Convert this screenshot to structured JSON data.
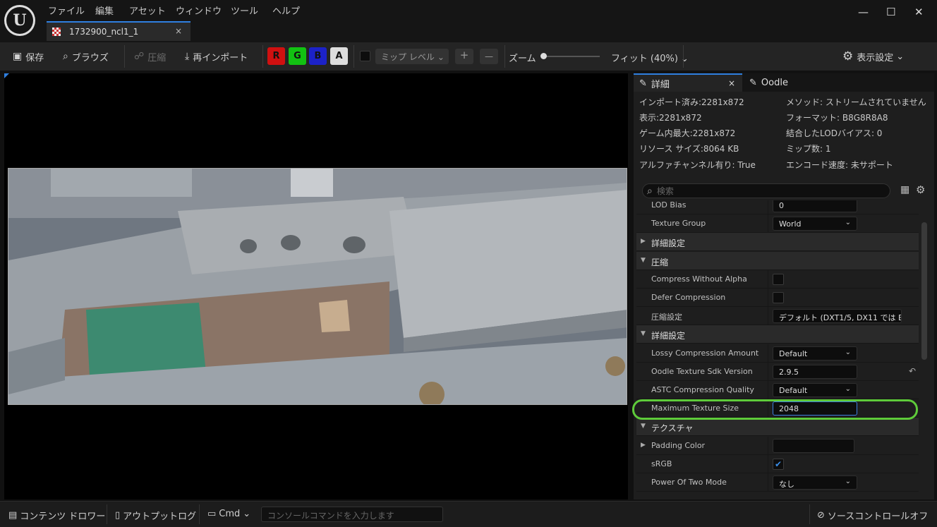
{
  "titlebar": {
    "logo": "U",
    "menu": [
      "ファイル",
      "編集",
      "アセット",
      "ウィンドウ",
      "ツール",
      "ヘルプ"
    ],
    "tab_title": "1732900_ncl1_1",
    "tab_close": "×",
    "minimize": "—",
    "maximize": "☐",
    "close": "✕"
  },
  "toolbar": {
    "save": "保存",
    "browse": "ブラウズ",
    "compress": "圧縮",
    "reimport": "再インポート",
    "channels": [
      {
        "label": "R",
        "bg": "#d01010",
        "fg": "#111"
      },
      {
        "label": "G",
        "bg": "#12c212",
        "fg": "#111"
      },
      {
        "label": "B",
        "bg": "#1c22c8",
        "fg": "#111"
      },
      {
        "label": "A",
        "bg": "#dddddd",
        "fg": "#111"
      }
    ],
    "mip_level": "ミップ レベル",
    "plus": "+",
    "minus": "—",
    "zoom_label": "ズーム",
    "zoom_value": "フィット (40%)",
    "view_settings": "表示設定"
  },
  "details": {
    "tab_details": "詳細",
    "tab_oodle": "Oodle",
    "info_left": [
      "インポート済み:2281x872",
      "表示:2281x872",
      "ゲーム内最大:2281x872",
      "リソース サイズ:8064 KB",
      "アルファチャンネル有り: True"
    ],
    "info_right": [
      "メソッド: ストリームされていません",
      "フォーマット: B8G8R8A8",
      "結合したLODバイアス: 0",
      "ミップ数: 1",
      "エンコード速度: 未サポート"
    ],
    "search_placeholder": "検索",
    "rows": [
      {
        "type": "prop",
        "label": "LOD Bias",
        "kind": "text",
        "value": "0"
      },
      {
        "type": "prop",
        "label": "Texture Group",
        "kind": "combo",
        "value": "World"
      },
      {
        "type": "cat",
        "label": "詳細設定",
        "open": false
      },
      {
        "type": "cat",
        "label": "圧縮",
        "open": true
      },
      {
        "type": "prop",
        "label": "Compress Without Alpha",
        "kind": "check",
        "checked": false
      },
      {
        "type": "prop",
        "label": "Defer Compression",
        "kind": "check",
        "checked": false
      },
      {
        "type": "prop",
        "label": "圧縮設定",
        "kind": "combo",
        "value": "デフォルト (DXT1/5, DX11 では E",
        "wide": true
      },
      {
        "type": "cat",
        "label": "詳細設定",
        "open": true
      },
      {
        "type": "prop",
        "label": "Lossy Compression Amount",
        "kind": "combo",
        "value": "Default"
      },
      {
        "type": "prop",
        "label": "Oodle Texture Sdk Version",
        "kind": "text",
        "value": "2.9.5",
        "reset": true
      },
      {
        "type": "prop",
        "label": "ASTC Compression Quality",
        "kind": "combo",
        "value": "Default"
      },
      {
        "type": "prop",
        "label": "Maximum Texture Size",
        "kind": "text",
        "value": "2048",
        "focused": true
      },
      {
        "type": "cat",
        "label": "テクスチャ",
        "open": true
      },
      {
        "type": "prop",
        "label": "Padding Color",
        "kind": "color",
        "value": "",
        "expander": true
      },
      {
        "type": "prop",
        "label": "sRGB",
        "kind": "check",
        "checked": true
      },
      {
        "type": "prop",
        "label": "Power Of Two Mode",
        "kind": "combo",
        "value": "なし"
      }
    ]
  },
  "bottom": {
    "content_drawer": "コンテンツ ドロワー",
    "output_log": "アウトプットログ",
    "cmd": "Cmd",
    "cmd_placeholder": "コンソールコマンドを入力します",
    "source_control": "ソースコントロールオフ"
  }
}
